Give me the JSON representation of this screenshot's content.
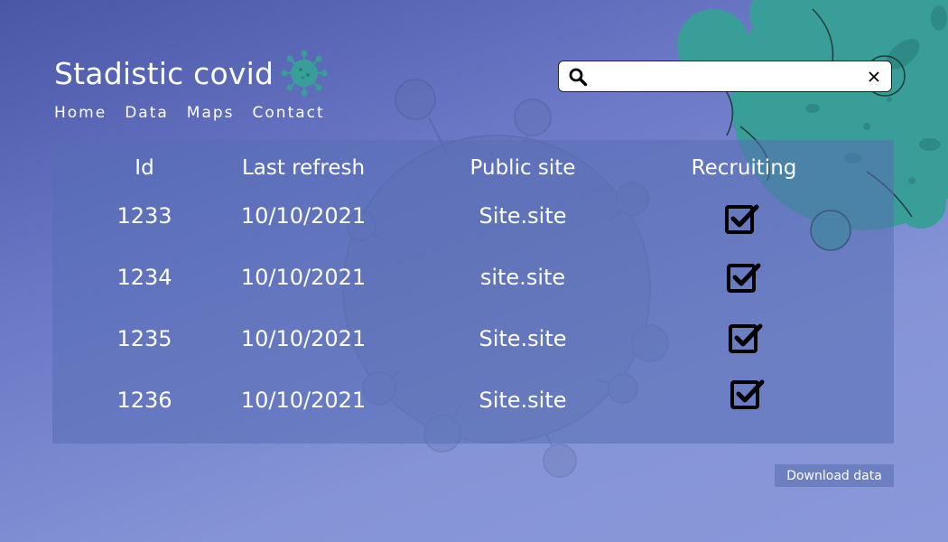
{
  "app": {
    "title": "Stadistic covid"
  },
  "nav": {
    "items": [
      {
        "label": "Home"
      },
      {
        "label": "Data"
      },
      {
        "label": "Maps"
      },
      {
        "label": "Contact"
      }
    ]
  },
  "search": {
    "value": "",
    "placeholder": ""
  },
  "table": {
    "headers": [
      "Id",
      "Last refresh",
      "Public site",
      "Recruiting"
    ],
    "rows": [
      {
        "id": "1233",
        "last_refresh": "10/10/2021",
        "public_site": "Site.site",
        "recruiting": true
      },
      {
        "id": "1234",
        "last_refresh": "10/10/2021",
        "public_site": "site.site",
        "recruiting": true
      },
      {
        "id": "1235",
        "last_refresh": "10/10/2021",
        "public_site": "Site.site",
        "recruiting": true
      },
      {
        "id": "1236",
        "last_refresh": "10/10/2021",
        "public_site": "Site.site",
        "recruiting": true
      }
    ]
  },
  "actions": {
    "download_label": "Download data"
  },
  "colors": {
    "background_top": "#4a56a6",
    "background_bottom": "#8a98da",
    "virus_teal": "#3a9e98",
    "panel": "#586eb4",
    "button": "#6c7fc0"
  },
  "icons": {
    "logo": "virus-icon",
    "search": "search-icon",
    "clear": "close-icon",
    "recruiting": "checkbox-checked-icon"
  }
}
